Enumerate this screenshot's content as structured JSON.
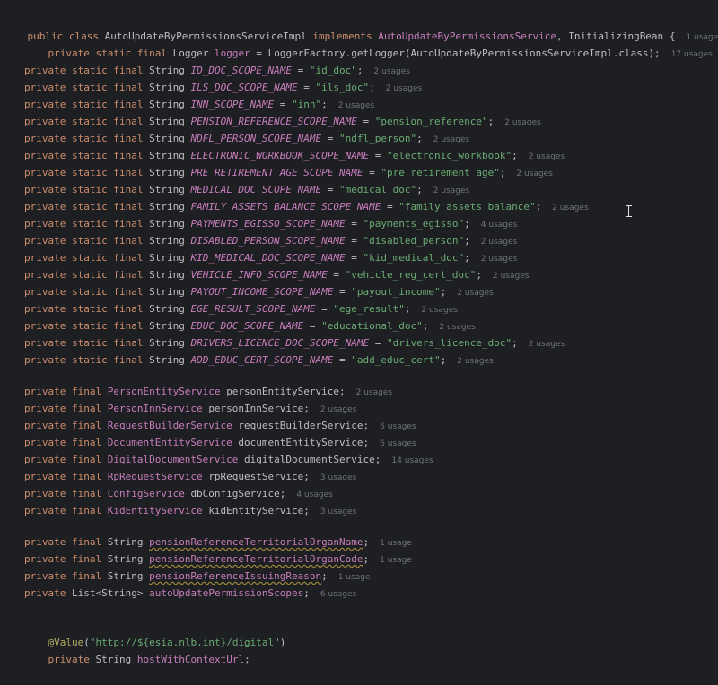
{
  "class_decl": {
    "public": "public",
    "class": "class",
    "name": "AutoUpdateByPermissionsServiceImpl",
    "implements": "implements",
    "iface1": "AutoUpdateByPermissionsService",
    "comma": ",",
    "iface2": "InitializingBean",
    "brace": "{",
    "usages": "1 usage"
  },
  "logger": {
    "mods": "private static final",
    "type": "Logger",
    "name": "logger",
    "eq": "=",
    "factory": "LoggerFactory",
    "call": ".getLogger(",
    "arg": "AutoUpdateByPermissionsServiceImpl",
    "tail": ".class);",
    "usages": "17 usages"
  },
  "constants": [
    {
      "mods": "private static final",
      "type": "String",
      "name": "ID_DOC_SCOPE_NAME",
      "value": "\"id_doc\"",
      "usages": "2 usages"
    },
    {
      "mods": "private static final",
      "type": "String",
      "name": "ILS_DOC_SCOPE_NAME",
      "value": "\"ils_doc\"",
      "usages": "2 usages"
    },
    {
      "mods": "private static final",
      "type": "String",
      "name": "INN_SCOPE_NAME",
      "value": "\"inn\"",
      "usages": "2 usages"
    },
    {
      "mods": "private static final",
      "type": "String",
      "name": "PENSION_REFERENCE_SCOPE_NAME",
      "value": "\"pension_reference\"",
      "usages": "2 usages"
    },
    {
      "mods": "private static final",
      "type": "String",
      "name": "NDFL_PERSON_SCOPE_NAME",
      "value": "\"ndfl_person\"",
      "usages": "2 usages"
    },
    {
      "mods": "private static final",
      "type": "String",
      "name": "ELECTRONIC_WORKBOOK_SCOPE_NAME",
      "value": "\"electronic_workbook\"",
      "usages": "2 usages"
    },
    {
      "mods": "private static final",
      "type": "String",
      "name": "PRE_RETIREMENT_AGE_SCOPE_NAME",
      "value": "\"pre_retirement_age\"",
      "usages": "2 usages"
    },
    {
      "mods": "private static final",
      "type": "String",
      "name": "MEDICAL_DOC_SCOPE_NAME",
      "value": "\"medical_doc\"",
      "usages": "2 usages"
    },
    {
      "mods": "private static final",
      "type": "String",
      "name": "FAMILY_ASSETS_BALANCE_SCOPE_NAME",
      "value": "\"family_assets_balance\"",
      "usages": "2 usages"
    },
    {
      "mods": "private static final",
      "type": "String",
      "name": "PAYMENTS_EGISSO_SCOPE_NAME",
      "value": "\"payments_egisso\"",
      "usages": "4 usages"
    },
    {
      "mods": "private static final",
      "type": "String",
      "name": "DISABLED_PERSON_SCOPE_NAME",
      "value": "\"disabled_person\"",
      "usages": "2 usages"
    },
    {
      "mods": "private static final",
      "type": "String",
      "name": "KID_MEDICAL_DOC_SCOPE_NAME",
      "value": "\"kid_medical_doc\"",
      "usages": "2 usages"
    },
    {
      "mods": "private static final",
      "type": "String",
      "name": "VEHICLE_INFO_SCOPE_NAME",
      "value": "\"vehicle_reg_cert_doc\"",
      "usages": "2 usages"
    },
    {
      "mods": "private static final",
      "type": "String",
      "name": "PAYOUT_INCOME_SCOPE_NAME",
      "value": "\"payout_income\"",
      "usages": "2 usages"
    },
    {
      "mods": "private static final",
      "type": "String",
      "name": "EGE_RESULT_SCOPE_NAME",
      "value": "\"ege_result\"",
      "usages": "2 usages"
    },
    {
      "mods": "private static final",
      "type": "String",
      "name": "EDUC_DOC_SCOPE_NAME",
      "value": "\"educational_doc\"",
      "usages": "2 usages"
    },
    {
      "mods": "private static final",
      "type": "String",
      "name": "DRIVERS_LICENCE_DOC_SCOPE_NAME",
      "value": "\"drivers_licence_doc\"",
      "usages": "2 usages"
    },
    {
      "mods": "private static final",
      "type": "String",
      "name": "ADD_EDUC_CERT_SCOPE_NAME",
      "value": "\"add_educ_cert\"",
      "usages": "2 usages"
    }
  ],
  "services": [
    {
      "mods": "private final",
      "type": "PersonEntityService",
      "name": "personEntityService",
      "usages": "2 usages"
    },
    {
      "mods": "private final",
      "type": "PersonInnService",
      "name": "personInnService",
      "usages": "2 usages"
    },
    {
      "mods": "private final",
      "type": "RequestBuilderService",
      "name": "requestBuilderService",
      "usages": "6 usages"
    },
    {
      "mods": "private final",
      "type": "DocumentEntityService",
      "name": "documentEntityService",
      "usages": "6 usages"
    },
    {
      "mods": "private final",
      "type": "DigitalDocumentService",
      "name": "digitalDocumentService",
      "usages": "14 usages"
    },
    {
      "mods": "private final",
      "type": "RpRequestService",
      "name": "rpRequestService",
      "usages": "3 usages"
    },
    {
      "mods": "private final",
      "type": "ConfigService",
      "name": "dbConfigService",
      "usages": "4 usages"
    },
    {
      "mods": "private final",
      "type": "KidEntityService",
      "name": "kidEntityService",
      "usages": "3 usages"
    }
  ],
  "strings": [
    {
      "mods": "private final",
      "type": "String",
      "name": "pensionReferenceTerritorialOrganName",
      "usages": "1 usage"
    },
    {
      "mods": "private final",
      "type": "String",
      "name": "pensionReferenceTerritorialOrganCode",
      "usages": "1 usage"
    },
    {
      "mods": "private final",
      "type": "String",
      "name": "pensionReferenceIssuingReason",
      "usages": "1 usage"
    },
    {
      "mods": "private",
      "type": "List<String>",
      "name": "autoUpdatePermissionScopes",
      "usages": "6 usages"
    }
  ],
  "value_annotation": {
    "at": "@Value",
    "open": "(",
    "string": "\"http://${esia.nlb.int}/digital\"",
    "close": ")"
  },
  "host_field": {
    "mods": "private",
    "type": "String",
    "name": "hostWithContextUrl",
    "semi": ";"
  }
}
